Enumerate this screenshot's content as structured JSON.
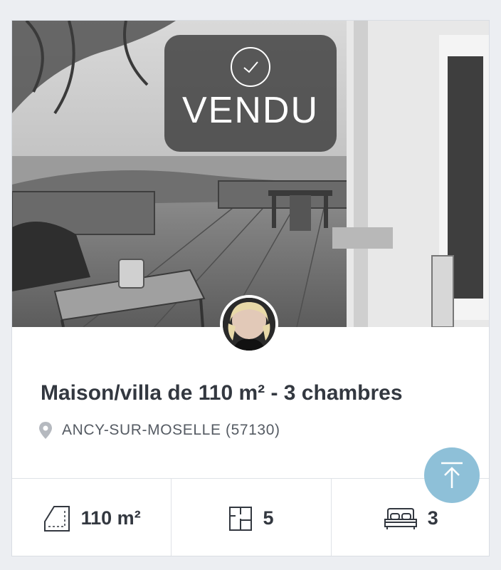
{
  "listing": {
    "status_label": "VENDU",
    "title": "Maison/villa de 110 m² - 3 chambres",
    "location": "ANCY-SUR-MOSELLE (57130)",
    "photo_icon": "terrace-photo",
    "agent_avatar_icon": "agent-avatar"
  },
  "features": {
    "surface": {
      "value": "110 m²",
      "icon": "surface-area-icon"
    },
    "rooms": {
      "value": "5",
      "icon": "floor-plan-icon"
    },
    "bedrooms": {
      "value": "3",
      "icon": "bed-icon"
    }
  },
  "scroll_top": {
    "icon": "arrow-up-icon"
  },
  "colors": {
    "accent": "#8ec0d8",
    "text_dark": "#333840",
    "text_muted": "#555b63",
    "badge_bg": "#3c3c3c"
  }
}
